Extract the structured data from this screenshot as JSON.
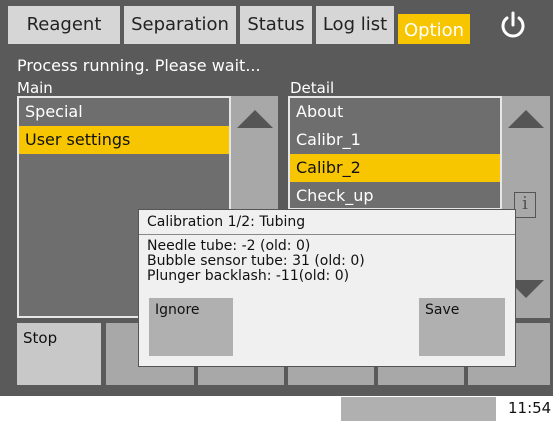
{
  "tabs": [
    {
      "label": "Reagent"
    },
    {
      "label": "Separation"
    },
    {
      "label": "Status"
    },
    {
      "label": "Log list"
    },
    {
      "label": "Option",
      "active": true
    }
  ],
  "power_icon": "power-icon",
  "status_text": "Process running. Please wait...",
  "main": {
    "label": "Main",
    "items": [
      {
        "label": "Special"
      },
      {
        "label": "User settings",
        "selected": true
      }
    ]
  },
  "detail": {
    "label": "Detail",
    "items": [
      {
        "label": "About"
      },
      {
        "label": "Calibr_1"
      },
      {
        "label": "Calibr_2",
        "selected": true
      },
      {
        "label": "Check_up"
      }
    ]
  },
  "bottom_buttons": {
    "stop_label": "Stop"
  },
  "dialog": {
    "title": "Calibration 1/2: Tubing",
    "lines": [
      "Needle tube: -2 (old: 0)",
      "Bubble sensor tube: 31 (old: 0)",
      "Plunger backlash: -11(old: 0)"
    ],
    "ignore_label": "Ignore",
    "save_label": "Save"
  },
  "footer": {
    "time": "11:54"
  },
  "colors": {
    "accent": "#f7c600",
    "background": "#5a5a5a",
    "button": "#a8a8a8"
  }
}
